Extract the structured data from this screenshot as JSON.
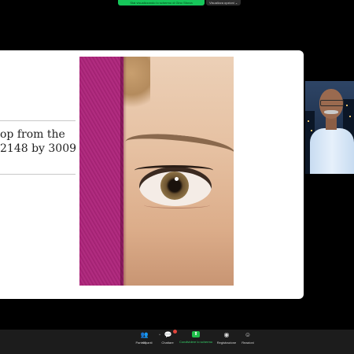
{
  "top_bar": {
    "share_status": "Stai visualizzando lo schermo di Gino Sforza",
    "view_options": "Visualizza opzioni ⌄"
  },
  "slide": {
    "text_line_1": "op from the",
    "text_line_2": "2148 by 3009"
  },
  "participant": {
    "video": "participant-video"
  },
  "toolbar": {
    "participants_label": "Partecipanti",
    "participants_count": "95",
    "chat_label": "Chattare",
    "share_label": "Condividere lo schermo",
    "record_label": "Registrazione",
    "reactions_label": "Reazioni"
  },
  "colors": {
    "share_green": "#16c65a",
    "toolbar_bg": "#1c1c1c",
    "slide_bg": "#ffffff",
    "scarf": "#a92378"
  }
}
